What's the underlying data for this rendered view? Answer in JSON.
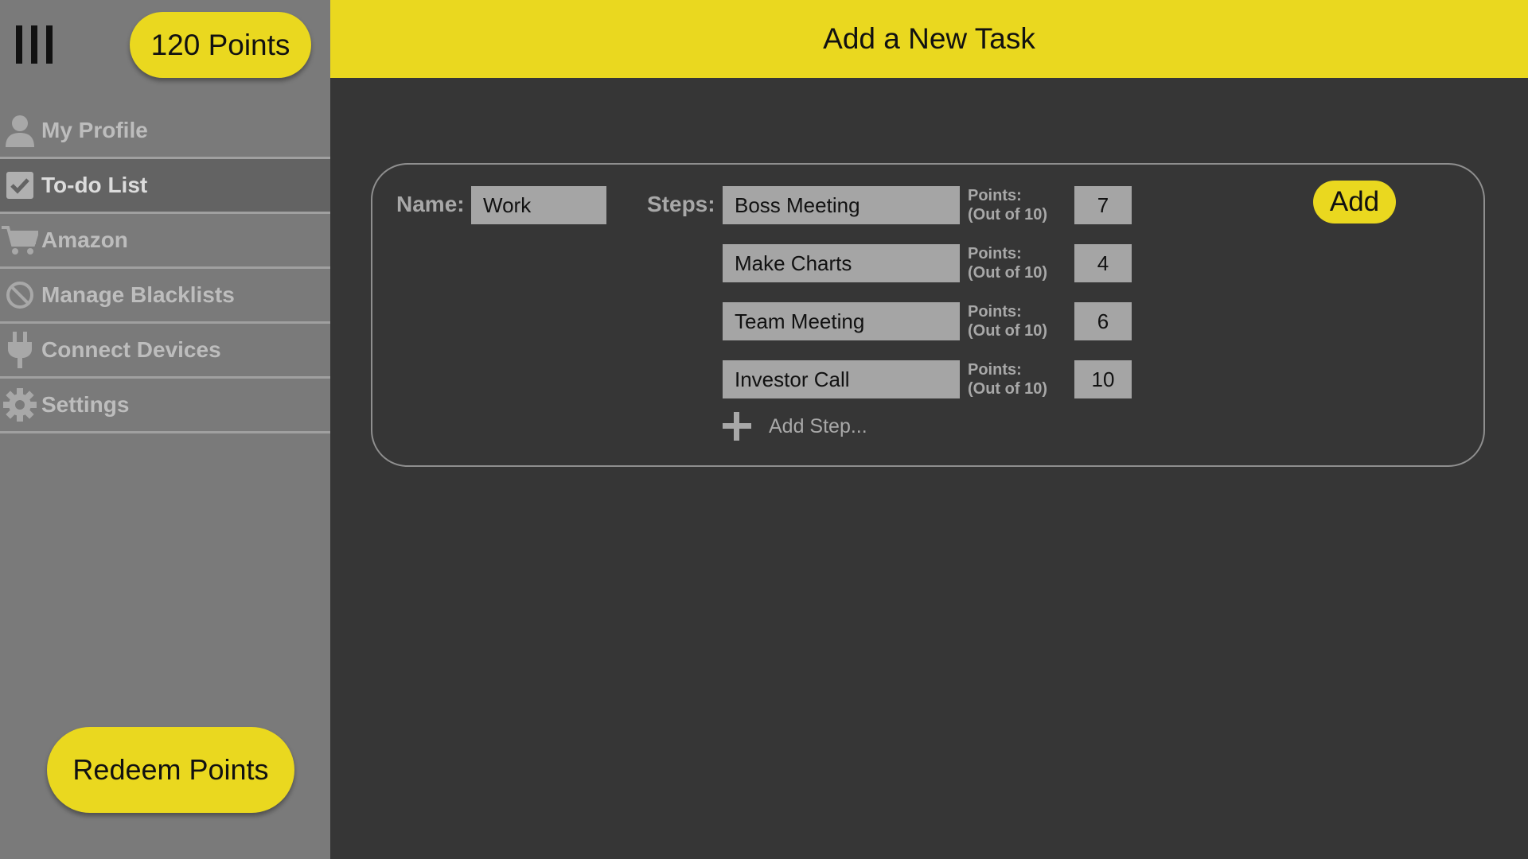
{
  "sidebar": {
    "menu_icon": "hamburger-icon",
    "points": "120 Points",
    "items": [
      {
        "label": "My Profile",
        "icon": "user-icon"
      },
      {
        "label": "To-do List",
        "icon": "checkbox-icon"
      },
      {
        "label": "Amazon",
        "icon": "cart-icon"
      },
      {
        "label": "Manage Blacklists",
        "icon": "block-icon"
      },
      {
        "label": "Connect Devices",
        "icon": "plug-icon"
      },
      {
        "label": "Settings",
        "icon": "gear-icon"
      }
    ],
    "active_item": "To-do List",
    "redeem_label": "Redeem Points"
  },
  "header": {
    "title": "Add a New Task"
  },
  "task_form": {
    "name_label": "Name:",
    "name_value": "Work",
    "steps_label": "Steps:",
    "points_label_line1": "Points:",
    "points_label_line2": "(Out of 10)",
    "steps": [
      {
        "name": "Boss Meeting",
        "points": "7"
      },
      {
        "name": "Make Charts",
        "points": "4"
      },
      {
        "name": "Team Meeting",
        "points": "6"
      },
      {
        "name": "Investor Call",
        "points": "10"
      }
    ],
    "add_step_label": "Add Step...",
    "add_button_label": "Add"
  },
  "colors": {
    "accent_yellow": "#ead81f",
    "sidebar_bg": "#7a7a7a",
    "main_bg": "#363636"
  }
}
